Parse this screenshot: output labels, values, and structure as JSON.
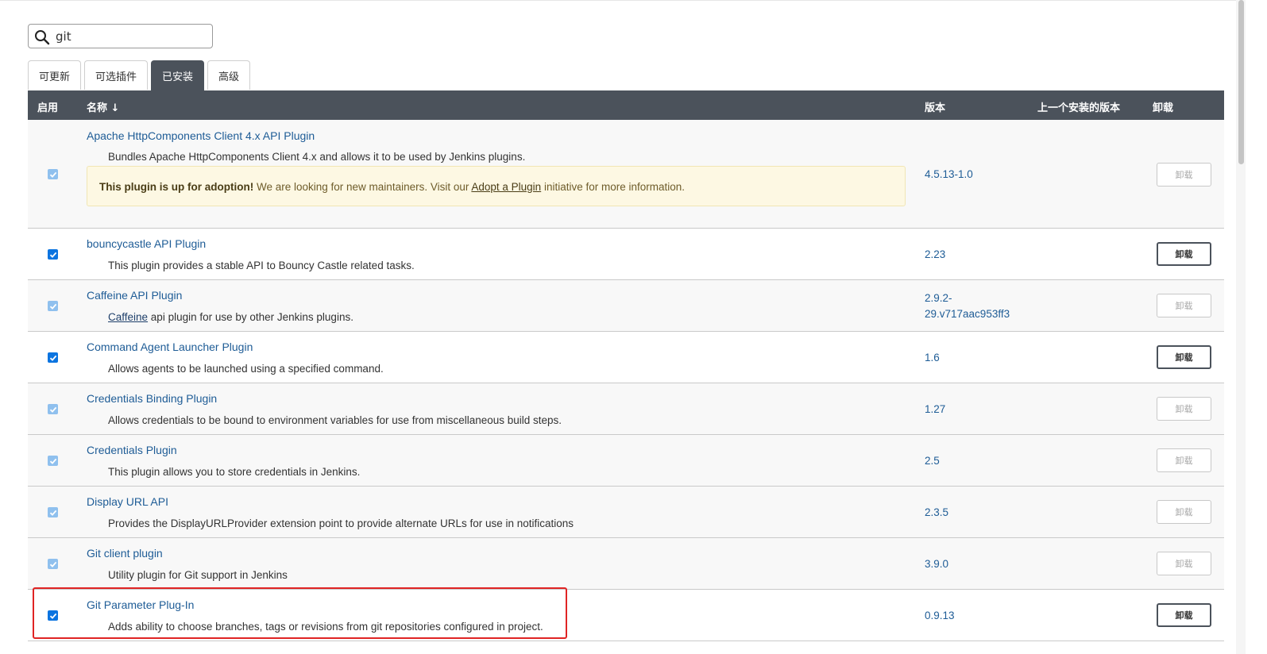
{
  "search": {
    "value": "git"
  },
  "tabs": [
    {
      "label": "可更新",
      "active": false
    },
    {
      "label": "可选插件",
      "active": false
    },
    {
      "label": "已安装",
      "active": true
    },
    {
      "label": "高级",
      "active": false
    }
  ],
  "table": {
    "headers": {
      "enabled": "启用",
      "name": "名称 ↓",
      "version": "版本",
      "previous": "上一个安装的版本",
      "uninstall": "卸载"
    },
    "rows": [
      {
        "name": "Apache HttpComponents Client 4.x API Plugin",
        "description": "Bundles Apache HttpComponents Client 4.x and allows it to be used by Jenkins plugins.",
        "version": "4.5.13-1.0",
        "enabled": true,
        "checkbox_disabled": true,
        "uninstall_enabled": false,
        "uninstall_label": "卸载",
        "adoption": {
          "bold": "This plugin is up for adoption!",
          "text1": " We are looking for new maintainers. Visit our ",
          "link": "Adopt a Plugin",
          "text2": " initiative for more information."
        }
      },
      {
        "name": "bouncycastle API Plugin",
        "description": "This plugin provides a stable API to Bouncy Castle related tasks.",
        "version": "2.23",
        "enabled": true,
        "checkbox_disabled": false,
        "uninstall_enabled": true,
        "uninstall_label": "卸载"
      },
      {
        "name": "Caffeine API Plugin",
        "description_link": "Caffeine",
        "description": " api plugin for use by other Jenkins plugins.",
        "version_line1": "2.9.2-",
        "version_line2": "29.v717aac953ff3",
        "enabled": true,
        "checkbox_disabled": true,
        "uninstall_enabled": false,
        "uninstall_label": "卸载"
      },
      {
        "name": "Command Agent Launcher Plugin",
        "description": "Allows agents to be launched using a specified command.",
        "version": "1.6",
        "enabled": true,
        "checkbox_disabled": false,
        "uninstall_enabled": true,
        "uninstall_label": "卸载"
      },
      {
        "name": "Credentials Binding Plugin",
        "description": "Allows credentials to be bound to environment variables for use from miscellaneous build steps.",
        "version": "1.27",
        "enabled": true,
        "checkbox_disabled": true,
        "uninstall_enabled": false,
        "uninstall_label": "卸载"
      },
      {
        "name": "Credentials Plugin",
        "description": "This plugin allows you to store credentials in Jenkins.",
        "version": "2.5",
        "enabled": true,
        "checkbox_disabled": true,
        "uninstall_enabled": false,
        "uninstall_label": "卸载"
      },
      {
        "name": "Display URL API",
        "description": "Provides the DisplayURLProvider extension point to provide alternate URLs for use in notifications",
        "version": "2.3.5",
        "enabled": true,
        "checkbox_disabled": true,
        "uninstall_enabled": false,
        "uninstall_label": "卸载"
      },
      {
        "name": "Git client plugin",
        "description": "Utility plugin for Git support in Jenkins",
        "version": "3.9.0",
        "enabled": true,
        "checkbox_disabled": true,
        "uninstall_enabled": false,
        "uninstall_label": "卸载"
      },
      {
        "name": "Git Parameter Plug-In",
        "description": "Adds ability to choose branches, tags or revisions from git repositories configured in project.",
        "version": "0.9.13",
        "enabled": true,
        "checkbox_disabled": false,
        "uninstall_enabled": true,
        "uninstall_label": "卸载",
        "highlighted": true
      }
    ]
  },
  "colors": {
    "header_bg": "#4b525b",
    "link": "#1e5c96",
    "checkbox": "#0b74e0",
    "highlight": "#e02424",
    "adoption_bg": "#fdf8e3"
  }
}
